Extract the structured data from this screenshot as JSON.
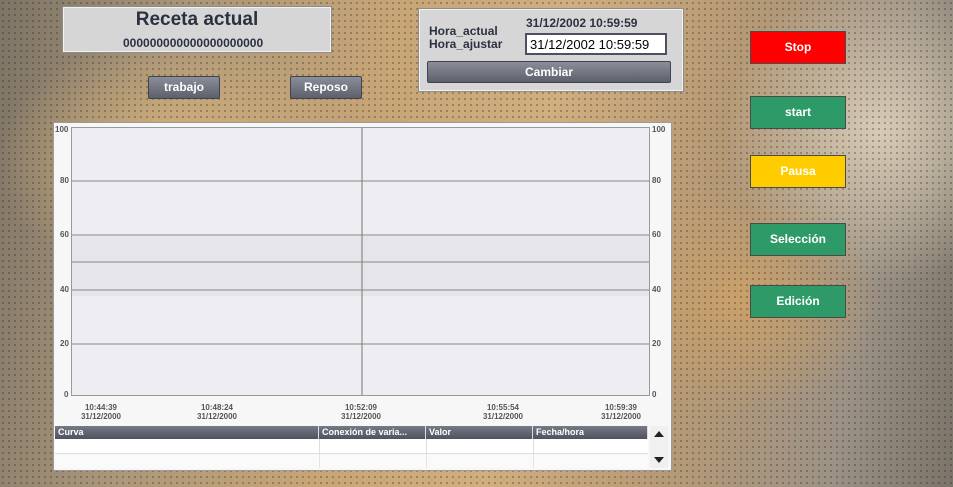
{
  "recipe": {
    "title": "Receta actual",
    "code": "000000000000000000000"
  },
  "mode_buttons": {
    "work": "trabajo",
    "rest": "Reposo"
  },
  "time_panel": {
    "current_label": "Hora_actual",
    "current_value": "31/12/2002 10:59:59",
    "adjust_label": "Hora_ajustar",
    "adjust_value": "31/12/2002 10:59:59",
    "change_button": "Cambiar"
  },
  "controls": [
    {
      "label": "Stop",
      "color": "#ff0000",
      "text_color": "#ffffff"
    },
    {
      "label": "start",
      "color": "#2e9a68",
      "text_color": "#ffffff"
    },
    {
      "label": "Pausa",
      "color": "#ffcc00",
      "text_color": "#ffffff"
    },
    {
      "label": "Selección",
      "color": "#2e9a68",
      "text_color": "#ffffff"
    },
    {
      "label": "Edición",
      "color": "#2e9a68",
      "text_color": "#ffffff"
    }
  ],
  "trend": {
    "y_ticks": [
      "100",
      "80",
      "60",
      "40",
      "20",
      "0"
    ],
    "x_ticks": [
      {
        "time": "10:44:39",
        "date": "31/12/2000"
      },
      {
        "time": "10:48:24",
        "date": "31/12/2000"
      },
      {
        "time": "10:52:09",
        "date": "31/12/2000"
      },
      {
        "time": "10:55:54",
        "date": "31/12/2000"
      },
      {
        "time": "10:59:39",
        "date": "31/12/2000"
      }
    ],
    "table_columns": [
      "Curva",
      "Conexión de varia...",
      "Valor",
      "Fecha/hora"
    ]
  }
}
